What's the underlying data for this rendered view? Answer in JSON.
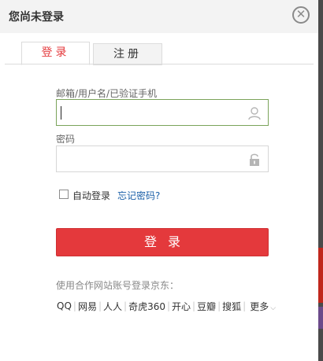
{
  "dialog": {
    "title": "您尚未登录",
    "close_glyph": "✕"
  },
  "tabs": {
    "login": "登录",
    "register": "注册"
  },
  "form": {
    "username_label": "邮箱/用户名/已验证手机",
    "username_value": "",
    "password_label": "密码",
    "password_value": "",
    "remember_label": "自动登录",
    "remember_checked": false,
    "forgot_link": "忘记密码?",
    "submit_label": "登录"
  },
  "partners": {
    "tip": "使用合作网站账号登录京东：",
    "items": [
      "QQ",
      "网易",
      "人人",
      "奇虎360",
      "开心",
      "豆瓣",
      "搜狐"
    ],
    "more_label": "更多",
    "more_glyph": "⌵"
  },
  "colors": {
    "accent": "#e4393c",
    "link": "#1a5fa8",
    "focus_border": "#7aa35a"
  }
}
